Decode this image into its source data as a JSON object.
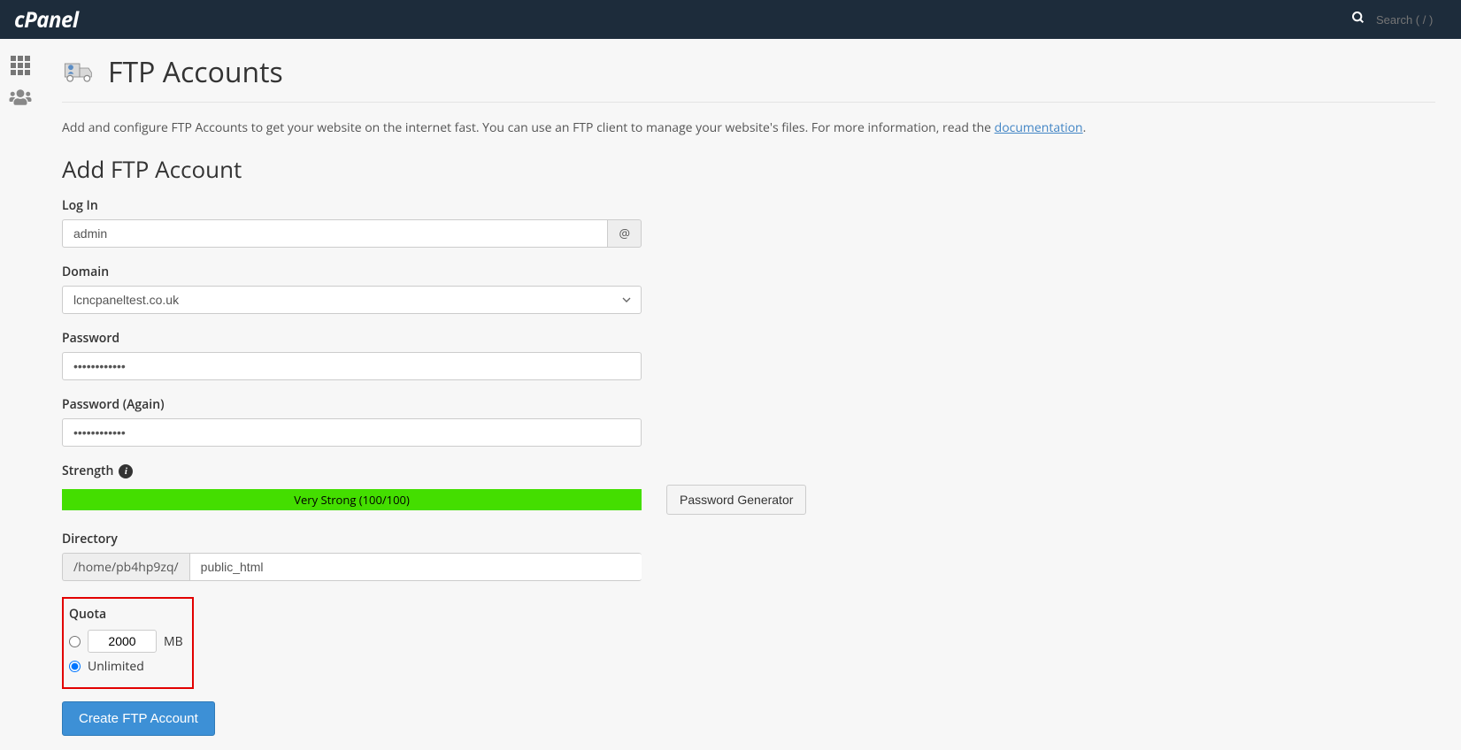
{
  "header": {
    "logo": "cPanel",
    "search_placeholder": "Search ( / )"
  },
  "page": {
    "title": "FTP Accounts",
    "description_pre": "Add and configure FTP Accounts to get your website on the internet fast. You can use an FTP client to manage your website's files. For more information, read the ",
    "description_link": "documentation",
    "description_post": ".",
    "section_title": "Add FTP Account"
  },
  "form": {
    "login_label": "Log In",
    "login_value": "admin",
    "at_symbol": "@",
    "domain_label": "Domain",
    "domain_value": "lcncpaneltest.co.uk",
    "password_label": "Password",
    "password_value": "••••••••••••",
    "password_again_label": "Password (Again)",
    "password_again_value": "••••••••••••",
    "strength_label": "Strength",
    "strength_text": "Very Strong (100/100)",
    "password_generator": "Password Generator",
    "directory_label": "Directory",
    "directory_prefix": "/home/pb4hp9zq/",
    "directory_value": "public_html",
    "quota_label": "Quota",
    "quota_value": "2000",
    "quota_unit": "MB",
    "quota_unlimited": "Unlimited",
    "submit": "Create FTP Account"
  }
}
